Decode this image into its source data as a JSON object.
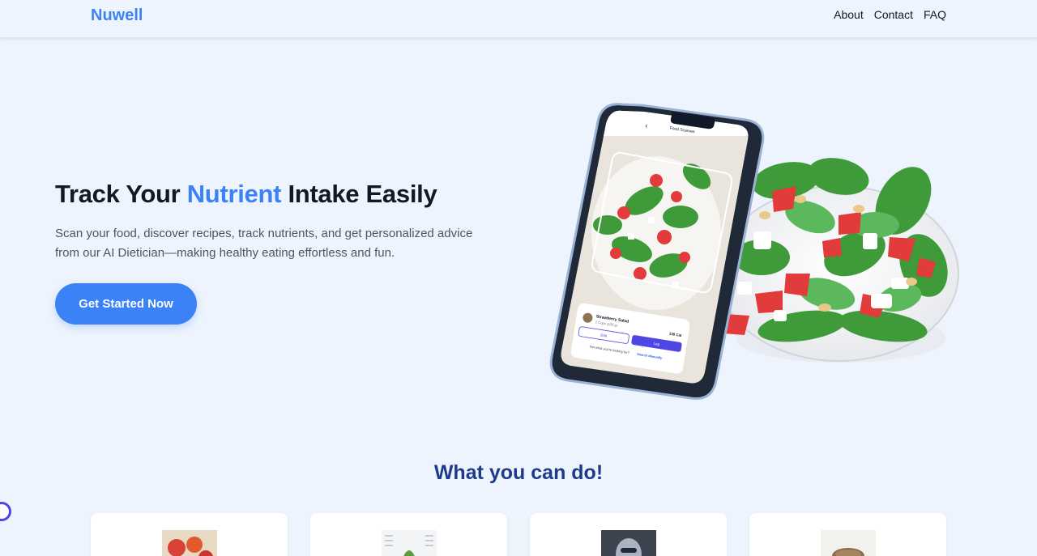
{
  "header": {
    "logo": "Nuwell",
    "nav": [
      "About",
      "Contact",
      "FAQ"
    ]
  },
  "hero": {
    "title_prefix": "Track Your ",
    "title_accent": "Nutrient",
    "title_suffix": " Intake Easily",
    "subtitle_line1": "Scan your food, discover recipes, track nutrients, and get personalized advice",
    "subtitle_line2": "from our AI Dietician—making healthy eating effortless and fun.",
    "cta_label": "Get Started Now"
  },
  "phone": {
    "screen_title": "Food Scanner",
    "back_glyph": "‹",
    "food_name": "Strawberry Salad",
    "portion": "2 Cups (100 g)",
    "calories": "130 Cal",
    "edit_label": "Edit",
    "log_label": "Log",
    "hint_text": "Not what you're looking for?",
    "hint_link": "Search Manually"
  },
  "features": {
    "title": "What you can do!",
    "cards": [
      {
        "icon": "food-photo-icon"
      },
      {
        "icon": "recipe-chart-icon"
      },
      {
        "icon": "robot-icon"
      },
      {
        "icon": "bowl-icon"
      }
    ]
  },
  "colors": {
    "accent": "#3b82f6",
    "background": "#eef4fd",
    "section_title": "#1e3a8a",
    "log_button": "#4f46e5"
  }
}
